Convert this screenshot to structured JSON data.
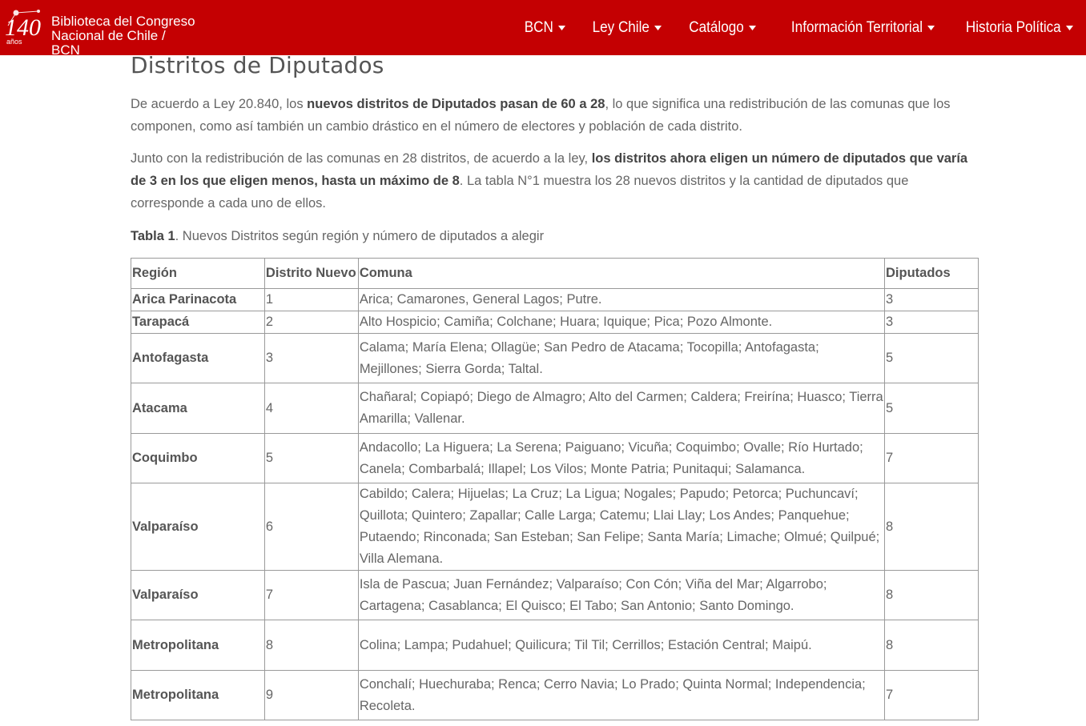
{
  "header": {
    "logo_number": "140",
    "logo_sub": "años",
    "logo_line1": "Biblioteca del Congreso",
    "logo_line2": "Nacional de Chile / BCN",
    "nav": [
      {
        "label": "BCN"
      },
      {
        "label": "Ley Chile"
      },
      {
        "label": "Catálogo"
      },
      {
        "label": "Información Territorial"
      },
      {
        "label": "Historia Política"
      }
    ]
  },
  "page": {
    "title": "Distritos de Diputados",
    "p1_a": "De acuerdo a Ley 20.840, los ",
    "p1_b": "nuevos distritos de Diputados pasan de 60 a 28",
    "p1_c": ", lo que significa una redistribución de las comunas que los componen, como así también un cambio drástico en el número de electores y población de cada distrito.",
    "p2_a": "Junto con la redistribución de las comunas en 28 distritos, de acuerdo a la ley, ",
    "p2_b": "los distritos ahora eligen un número de diputados que varía de 3 en los que eligen menos, hasta un máximo de 8",
    "p2_c": ". La tabla N°1 muestra los 28 nuevos distritos y la cantidad de diputados que corresponde a cada uno de ellos.",
    "caption_label": "Tabla 1",
    "caption_text": ".  Nuevos Distritos según región y número de diputados a alegir"
  },
  "table": {
    "headers": [
      "Región",
      "Distrito Nuevo",
      "Comuna",
      "Diputados"
    ],
    "rows": [
      [
        "Arica Parinacota",
        "1",
        "Arica; Camarones, General Lagos; Putre.",
        "3"
      ],
      [
        "Tarapacá",
        "2",
        "Alto Hospicio; Camiña; Colchane; Huara; Iquique; Pica; Pozo Almonte.",
        "3"
      ],
      [
        "Antofagasta",
        "3",
        "Calama; María Elena; Ollagüe; San Pedro de Atacama; Tocopilla; Antofagasta; Mejillones; Sierra Gorda; Taltal.",
        "5"
      ],
      [
        "Atacama",
        "4",
        "Chañaral; Copiapó; Diego de Almagro; Alto del Carmen; Caldera; Freirína; Huasco; Tierra Amarilla; Vallenar.",
        "5"
      ],
      [
        "Coquimbo",
        "5",
        "Andacollo; La Higuera; La Serena; Paiguano; Vicuña; Coquimbo; Ovalle; Río Hurtado; Canela; Combarbalá; Illapel; Los Vilos; Monte Patria; Punitaqui; Salamanca.",
        "7"
      ],
      [
        "Valparaíso",
        "6",
        "Cabildo; Calera; Hijuelas; La Cruz; La Ligua; Nogales; Papudo; Petorca; Puchuncaví; Quillota; Quintero; Zapallar; Calle Larga; Catemu; Llai Llay; Los Andes; Panquehue; Putaendo; Rinconada; San Esteban; San Felipe; Santa María; Limache; Olmué; Quilpué; Villa Alemana.",
        "8"
      ],
      [
        "Valparaíso",
        "7",
        "Isla de Pascua; Juan Fernández; Valparaíso; Con Cón; Viña del Mar; Algarrobo; Cartagena; Casablanca; El Quisco; El Tabo; San Antonio; Santo Domingo.",
        "8"
      ],
      [
        "Metropolitana",
        "8",
        "Colina; Lampa; Pudahuel; Quilicura; Til Til; Cerrillos; Estación Central; Maipú.",
        "8"
      ],
      [
        "Metropolitana",
        "9",
        "Conchalí; Huechuraba; Renca; Cerro Navia; Lo Prado; Quinta Normal; Independencia; Recoleta.",
        "7"
      ]
    ]
  }
}
